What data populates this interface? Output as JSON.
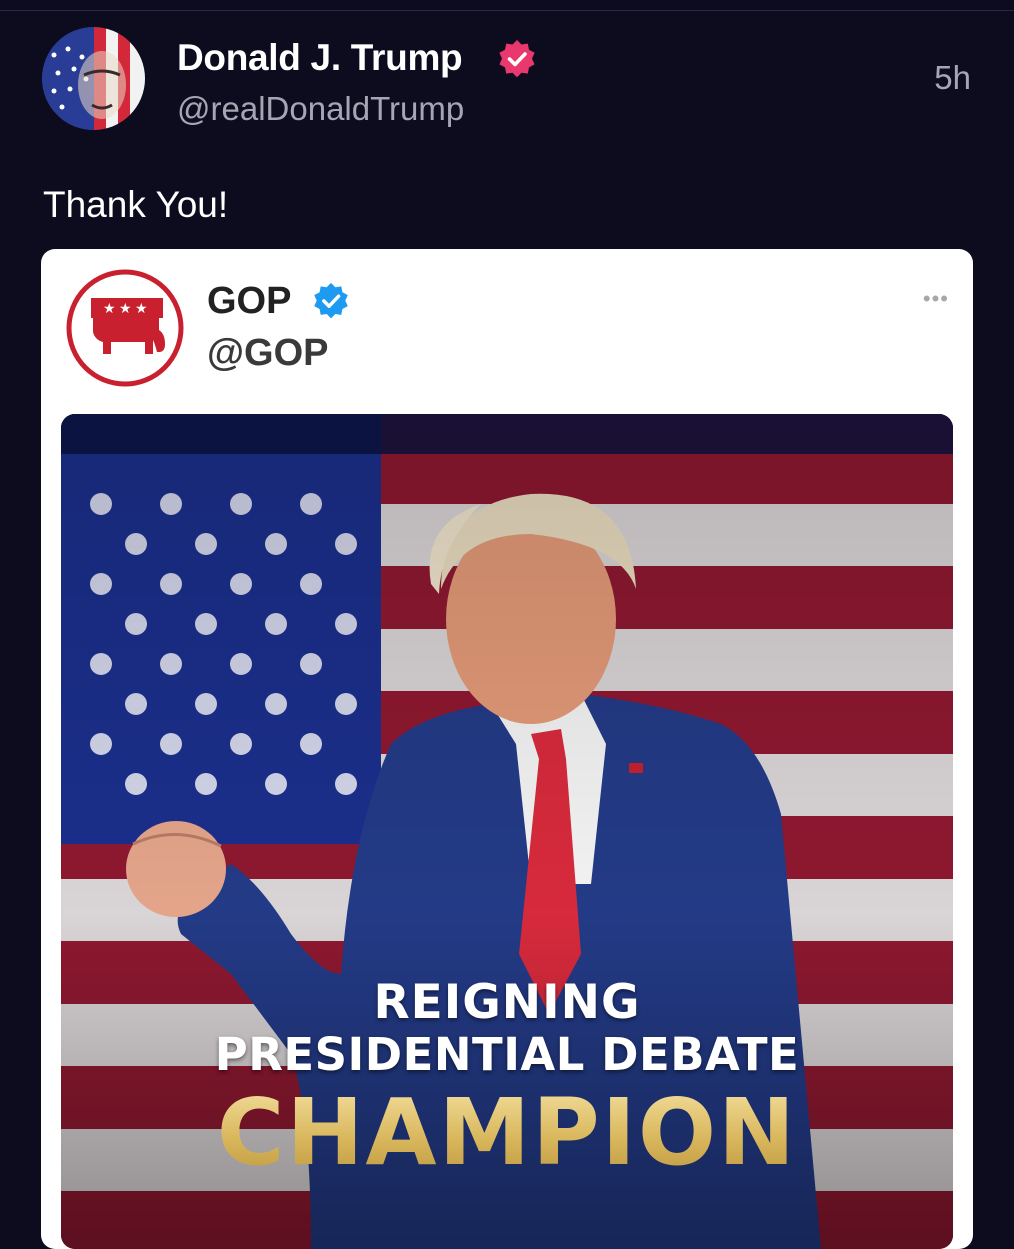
{
  "post": {
    "author_name": "Donald J. Trump",
    "author_handle": "@realDonaldTrump",
    "timestamp": "5h",
    "text": "Thank You!"
  },
  "embedded_post": {
    "account_name": "GOP",
    "account_handle": "@GOP",
    "more_label": "•••",
    "image": {
      "caption_line1": "REIGNING",
      "caption_line2": "PRESIDENTIAL DEBATE",
      "caption_line3": "CHAMPION"
    }
  },
  "colors": {
    "background": "#0d0b1e",
    "verified_pink": "#e8386d",
    "verified_blue": "#1d9bf0",
    "gop_red": "#c8202f",
    "gold": "#d9b75c"
  },
  "icons": {
    "author_verified": "verified-badge-icon",
    "gop_verified": "verified-check-icon",
    "gop_logo": "republican-elephant-logo",
    "more": "more-options-icon"
  }
}
